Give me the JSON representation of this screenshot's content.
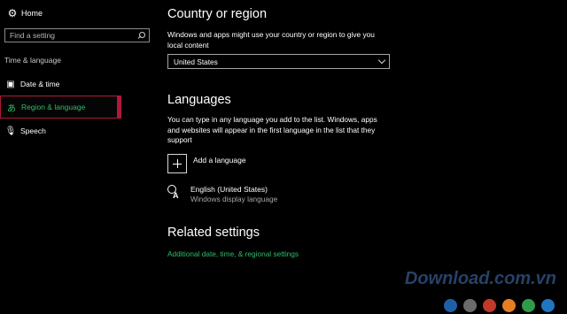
{
  "sidebar": {
    "home_label": "Home",
    "search_placeholder": "Find a setting",
    "section_label": "Time & language",
    "items": [
      {
        "label": "Date & time"
      },
      {
        "label": "Region & language"
      },
      {
        "label": "Speech"
      }
    ]
  },
  "main": {
    "country": {
      "heading": "Country or region",
      "description": "Windows and apps might use your country or region to give you local content",
      "selected": "United States"
    },
    "languages": {
      "heading": "Languages",
      "description": "You can type in any language you add to the list. Windows, apps and websites will appear in the first language in the list that they support",
      "add_label": "Add a language",
      "entries": [
        {
          "name": "English (United States)",
          "subtitle": "Windows display language"
        }
      ]
    },
    "related": {
      "heading": "Related settings",
      "link": "Additional date, time, & regional settings"
    }
  },
  "watermark": {
    "text": "Download.com.vn",
    "dot_colors": [
      "#1e5fa8",
      "#6b6b6b",
      "#c0392b",
      "#e67e22",
      "#2f9c4a",
      "#1f76c0"
    ]
  },
  "colors": {
    "accent_green": "#2fbf6a",
    "active_border": "#b0183a"
  }
}
